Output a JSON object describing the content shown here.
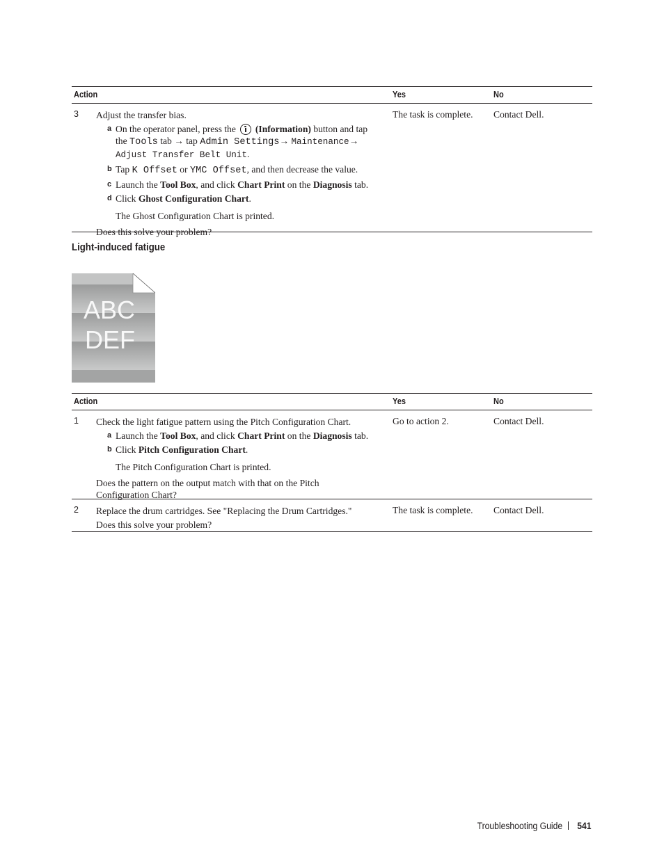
{
  "table1": {
    "headers": {
      "action": "Action",
      "yes": "Yes",
      "no": "No"
    },
    "rows": [
      {
        "num": "3",
        "intro": "Adjust the transfer bias.",
        "steps": {
          "a": {
            "letter": "a",
            "t1": "On the operator panel, press the",
            "icon": "information-icon",
            "t2": "(Information)",
            "t3": " button and tap",
            "t4": "the ",
            "m1": "Tools",
            "t5": " tab → tap ",
            "m2": "Admin Settings",
            "t6": "→ ",
            "m3": "Maintenance",
            "t7": "→",
            "m4": "Adjust Transfer Belt Unit",
            "t8": "."
          },
          "b": {
            "letter": "b",
            "t1": "Tap ",
            "m1": "K Offset",
            "t2": " or ",
            "m2": "YMC Offset",
            "t3": ", and then decrease the value."
          },
          "c": {
            "letter": "c",
            "t1": "Launch the ",
            "b1": "Tool Box",
            "t2": ", and click ",
            "b2": "Chart Print",
            "t3": " on the ",
            "b3": "Diagnosis",
            "t4": " tab."
          },
          "d": {
            "letter": "d",
            "t1": "Click ",
            "b1": "Ghost Configuration Chart",
            "t2": "."
          }
        },
        "note": "The Ghost Configuration Chart is printed.",
        "question": "Does this solve your problem?",
        "yes": "The task is complete.",
        "no": "Contact Dell."
      }
    ]
  },
  "section": {
    "title": "Light-induced fatigue",
    "sample_text_line1": "ABC",
    "sample_text_line2": "DEF"
  },
  "table2": {
    "headers": {
      "action": "Action",
      "yes": "Yes",
      "no": "No"
    },
    "rows": [
      {
        "num": "1",
        "intro": "Check the light fatigue pattern using the Pitch Configuration Chart.",
        "steps": {
          "a": {
            "letter": "a",
            "t1": "Launch the ",
            "b1": "Tool Box",
            "t2": ", and click ",
            "b2": "Chart Print",
            "t3": " on the ",
            "b3": "Diagnosis",
            "t4": " tab."
          },
          "b": {
            "letter": "b",
            "t1": "Click ",
            "b1": "Pitch Configuration Chart",
            "t2": "."
          }
        },
        "note": "The Pitch Configuration Chart is printed.",
        "question_line1": "Does the pattern on the output match with that on the Pitch",
        "question_line2": "Configuration Chart?",
        "yes": "Go to action 2.",
        "no": "Contact Dell."
      },
      {
        "num": "2",
        "intro": "Replace the drum cartridges. See \"Replacing the Drum Cartridges.\"",
        "question": "Does this solve your problem?",
        "yes": "The task is complete.",
        "no": "Contact Dell."
      }
    ]
  },
  "footer": {
    "title": "Troubleshooting Guide",
    "page_number": "541"
  }
}
